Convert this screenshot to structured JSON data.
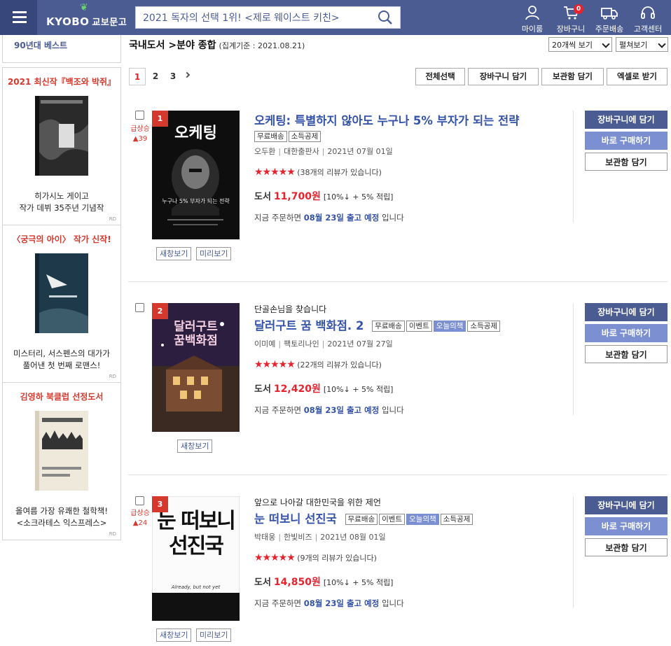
{
  "header": {
    "logo_en": "KYOBO",
    "logo_ko": "교보문고",
    "search_placeholder": "2021 독자의 선택 1위! <제로 웨이스트 키친>",
    "nav": [
      {
        "label": "마이룸",
        "icon": "user-icon"
      },
      {
        "label": "장바구니",
        "icon": "cart-icon",
        "badge": "0"
      },
      {
        "label": "주문배송",
        "icon": "truck-icon"
      },
      {
        "label": "고객센터",
        "icon": "headset-icon"
      }
    ]
  },
  "sidebar": {
    "top_link": "90년대 베스트",
    "ads": [
      {
        "title": "2021 최신작『백조와 박쥐』",
        "caption1": "히가시노 게이고",
        "caption2": "작가 데뷔 35주년 기념작",
        "rd": "RD"
      },
      {
        "title": "〈궁극의 아이〉 작가 신작!",
        "caption1": "미스터리, 서스펜스의 대가가",
        "caption2": "풀어낸 첫 번째 로맨스!",
        "rd": "RD"
      },
      {
        "title": "김영하 북클럽 선정도서",
        "caption1": "올여름 가장 유쾌한 철학책!",
        "caption2": "<소크라테스 익스프레스>",
        "rd": "RD"
      }
    ]
  },
  "main": {
    "breadcrumb": "국내도서 >분야 종합",
    "date_note": "(집계기준 : 2021.08.21)",
    "view_count": "20개씩 보기",
    "view_mode": "펼쳐보기",
    "pages": [
      "1",
      "2",
      "3"
    ],
    "toolbar": {
      "select_all": "전체선택",
      "add_cart": "장바구니 담기",
      "save": "보관함 담기",
      "excel": "엑셀로 받기"
    }
  },
  "items": [
    {
      "rank": "1",
      "change_label": "급상승",
      "change_value": "▲39",
      "subtitle": "",
      "title": "오케팅: 특별하지 않아도 누구나 5% 부자가 되는 전략",
      "tags": [
        "무료배송",
        "소득공제"
      ],
      "author": "오두환",
      "publisher": "대한출판사",
      "date": "2021년 07월 01일",
      "stars": "★★★★★",
      "reviews": "(38개의 리뷰가 있습니다)",
      "price_label": "도서",
      "price": "11,700원",
      "discount": "[10%↓ + 5% 적립]",
      "ship_pre": "지금 주문하면",
      "ship_date": "08월 23일 출고 예정",
      "ship_post": "입니다",
      "preview_buttons": [
        "새창보기",
        "미리보기"
      ],
      "cover_title": "오케팅",
      "cover_sub": "누구나 5% 부자가 되는 전략"
    },
    {
      "rank": "2",
      "change_label": "",
      "change_value": "",
      "subtitle": "단골손님을 찾습니다",
      "title": "달러구트 꿈 백화점. 2",
      "tags": [
        "무료배송",
        "이벤트",
        "오늘의책",
        "소득공제"
      ],
      "author": "이미예",
      "publisher": "팩토리나인",
      "date": "2021년 07월 27일",
      "stars": "★★★★★",
      "reviews": "(22개의 리뷰가 있습니다)",
      "price_label": "도서",
      "price": "12,420원",
      "discount": "[10%↓ + 5% 적립]",
      "ship_pre": "지금 주문하면",
      "ship_date": "08월 23일 출고 예정",
      "ship_post": "입니다",
      "preview_buttons": [
        "새창보기"
      ],
      "cover_title": "달러구트",
      "cover_sub": "꿈백화점"
    },
    {
      "rank": "3",
      "change_label": "급상승",
      "change_value": "▲24",
      "subtitle": "앞으로 나아갈 대한민국을 위한 제언",
      "title": "눈 떠보니 선진국",
      "tags": [
        "무료배송",
        "이벤트",
        "오늘의책",
        "소득공제"
      ],
      "author": "박태웅",
      "publisher": "한빛비즈",
      "date": "2021년 08월 01일",
      "stars": "★★★★★",
      "reviews": "(9개의 리뷰가 있습니다)",
      "price_label": "도서",
      "price": "14,850원",
      "discount": "[10%↓ + 5% 적립]",
      "ship_pre": "지금 주문하면",
      "ship_date": "08월 23일 출고 예정",
      "ship_post": "입니다",
      "preview_buttons": [
        "새창보기",
        "미리보기"
      ],
      "cover_title": "눈 떠보니 선진국",
      "cover_sub": "Already, but not yet"
    }
  ],
  "actions": {
    "cart": "장바구니에 담기",
    "buy": "바로 구매하기",
    "save": "보관함 담기"
  },
  "colors": {
    "header_bg": "#4b5c93",
    "accent_red": "#d5382c",
    "title_blue": "#3553a8",
    "button_light": "#7b8fd1"
  }
}
